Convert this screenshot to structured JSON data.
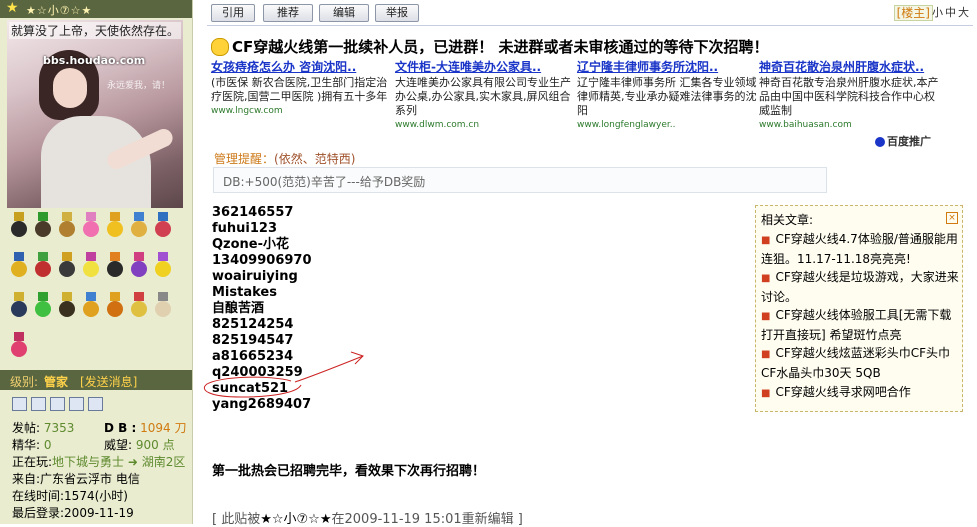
{
  "sidebar": {
    "header_text": "★☆小⑦☆★",
    "signature": "就算没了上帝，天使依然存在。",
    "avatar_site_text": "bbs.houdao.com",
    "avatar_watermark": "永远爱我，请！",
    "level_label": "级别:",
    "level_value": "管家",
    "send_message": "[发送消息]",
    "stats": {
      "posts_label": "发帖:",
      "posts_value": "7353",
      "db_label": "D B :",
      "db_value": "1094 刀",
      "essence_label": "精华:",
      "essence_value": "0",
      "prestige_label": "威望:",
      "prestige_value": "900 点",
      "playing_label": "正在玩:",
      "playing_game": "地下城与勇士",
      "playing_region": "湖南2区",
      "from_label": "来自:",
      "from_value": "广东省云浮市 电信",
      "online_label": "在线时间:",
      "online_value": "1574(小时)",
      "last_login_label": "最后登录:",
      "last_login_value": "2009-11-19"
    }
  },
  "toolbar": {
    "quote": "引用",
    "recommend": "推荐",
    "edit": "编辑",
    "report": "举报"
  },
  "floor": {
    "label": "[楼主]",
    "sizes": "小中大"
  },
  "post": {
    "title": "CF穿越火线第一批续补人员，已进群！  未进群或者未审核通过的等待下次招聘！",
    "manager_notice_label": "管理提醒：",
    "manager_notice_names": "(依然、范特西)",
    "db_notice": "DB:+500(范范)辛苦了---给予DB奖励",
    "ids": [
      "362146557",
      "fuhui123",
      "Qzone-小花",
      "13409906970",
      "woairuiying",
      "Mistakes",
      "自酿苦酒",
      "825124254",
      "825194547",
      "a81665234",
      "q240003259",
      "suncat521",
      "yang2689407"
    ],
    "closing": "第一批热会已招聘完毕，看效果下次再行招聘！",
    "edited_prefix": "[ 此贴被",
    "edited_by": "★☆小⑦☆★",
    "edited_suffix": "在2009-11-19 15:01重新编辑 ]"
  },
  "ads": [
    {
      "title": "女孩痔疮怎么办 咨询沈阳..",
      "body": "(市医保 新农合医院,卫生部门指定治疗医院,国营二甲医院 )拥有五十多年",
      "url": "www.lngcw.com"
    },
    {
      "title": "文件柜-大连唯美办公家具..",
      "body": "大连唯美办公家具有限公司专业生产办公桌,办公家具,实木家具,屏风组合系列",
      "url": "www.dlwm.com.cn"
    },
    {
      "title": "辽宁隆丰律师事务所沈阳..",
      "body": "辽宁隆丰律师事务所 汇集各专业领域律师精英,专业承办疑难法律事务的沈阳",
      "url": "www.longfenglawyer.."
    },
    {
      "title": "神奇百花散治泉州肝腹水症状..",
      "body": "神奇百花散专治泉州肝腹水症状,本产品由中国中医科学院科技合作中心权威监制",
      "url": "www.baihuasan.com"
    }
  ],
  "baidu_label": "百度推广",
  "related": {
    "heading": "相关文章:",
    "close_symbol": "×",
    "items": [
      "CF穿越火线4.7体验服/普通服能用连狙。11.17-11.18亮亮亮!",
      "CF穿越火线是垃圾游戏，大家进来讨论。",
      "CF穿越火线体验服工具[无需下载打开直接玩] 希望斑竹点亮",
      "CF穿越火线炫蓝迷彩头巾CF头巾CF水晶头巾30天 5QB",
      "CF穿越火线寻求网吧合作"
    ]
  },
  "colors": {
    "sidebar_bg": "#e9eccf",
    "bar_bg": "#5a6640",
    "accent_orange": "#d07a10",
    "ad_link": "#1a35c8",
    "annotation_red": "#cc2222"
  }
}
